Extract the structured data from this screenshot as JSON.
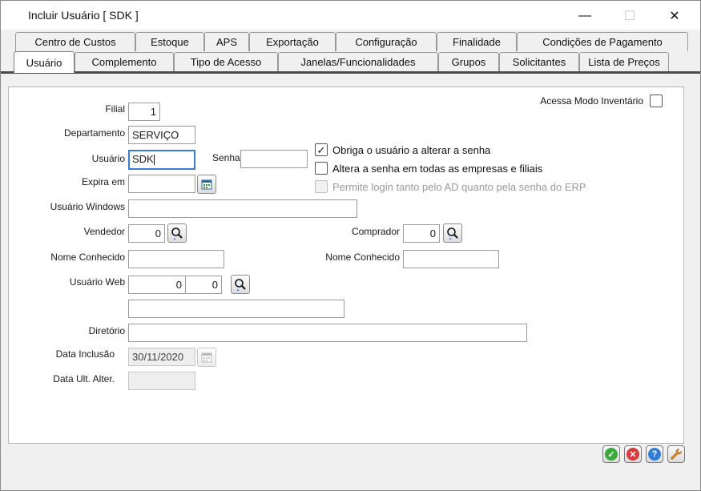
{
  "window": {
    "title": "Incluir Usuário [ SDK ]",
    "minimize": "—",
    "maximize": "☐",
    "close": "✕"
  },
  "tabs_row1": [
    "Centro de Custos",
    "Estoque",
    "APS",
    "Exportação",
    "Configuração",
    "Finalidade",
    "Condições de Pagamento"
  ],
  "tabs_row2": [
    "Usuário",
    "Complemento",
    "Tipo de Acesso",
    "Janelas/Funcionalidades",
    "Grupos",
    "Solicitantes",
    "Lista de Preços"
  ],
  "active_tab": "Usuário",
  "form": {
    "filial_label": "Filial",
    "filial_value": "1",
    "departamento_label": "Departamento",
    "departamento_value": "SERVIÇO",
    "usuario_label": "Usuário",
    "usuario_value": "SDK",
    "senha_label": "Senha",
    "senha_value": "",
    "expira_label": "Expira em",
    "expira_value": "",
    "usuario_windows_label": "Usuário Windows",
    "usuario_windows_value": "",
    "vendedor_label": "Vendedor",
    "vendedor_value": "0",
    "comprador_label": "Comprador",
    "comprador_value": "0",
    "nome_conhecido_vend_label": "Nome Conhecido",
    "nome_conhecido_vend_value": "",
    "nome_conhecido_comp_label": "Nome Conhecido",
    "nome_conhecido_comp_value": "",
    "usuario_web_label": "Usuário Web",
    "usuario_web_value1": "0",
    "usuario_web_value2": "0",
    "usuario_web_name_value": "",
    "diretorio_label": "Diretório",
    "diretorio_value": "",
    "data_inclusao_label": "Data Inclusão",
    "data_inclusao_value": "30/11/2020",
    "data_ult_alter_label": "Data Ult. Alter.",
    "data_ult_alter_value": ""
  },
  "checkboxes": {
    "modo_inventario_label": "Acessa Modo Inventário",
    "modo_inventario_checked": false,
    "obriga_label": "Obriga o usuário a alterar a senha",
    "obriga_checked": true,
    "altera_label": "Altera a senha em todas as empresas e filiais",
    "altera_checked": false,
    "permite_label": "Permite login tanto pelo AD quanto pela senha do ERP",
    "permite_checked": false,
    "check_glyph": "✓"
  },
  "icons": {
    "search": "magnifier-icon",
    "calendar": "calendar-icon",
    "confirm": "check-icon",
    "cancel": "x-icon",
    "help": "question-icon",
    "tools": "wrench-icon"
  },
  "action_glyphs": {
    "confirm": "✓",
    "cancel": "✕",
    "help": "?"
  },
  "colors": {
    "confirm": "#3aa83a",
    "cancel": "#d93a3a",
    "help": "#2f7fd9",
    "tools": "#e08a1e",
    "focus_border": "#3a7bd5"
  }
}
